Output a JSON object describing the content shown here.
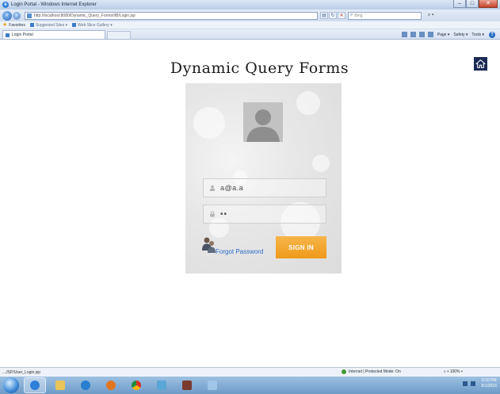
{
  "window": {
    "title": "Login Portal - Windows Internet Explorer",
    "minimize": "–",
    "maximize": "□",
    "close": "✕"
  },
  "addressbar": {
    "url": "http://localhost:8080/Dynamic_Query_Forms/IIB/Login.jsp",
    "search_placeholder": "Bing"
  },
  "favorites": {
    "label": "Favorites",
    "items": [
      "Suggested Sites ▾",
      "Web Slice Gallery ▾"
    ]
  },
  "tab": {
    "label": "Login Portal"
  },
  "commandbar": {
    "page": "Page ▾",
    "safety": "Safety ▾",
    "tools": "Tools ▾",
    "help": "?"
  },
  "page": {
    "title": "Dynamic Query Forms",
    "username_value": "a@a.a",
    "password_value": "••",
    "forgot_label": "Forgot Password",
    "signin_label": "SIGN IN"
  },
  "statusbar": {
    "link_url": "...JSP/User_Login.jsp",
    "zone": "Internet | Protected Mode: On",
    "zoom": "100%"
  },
  "taskbar": {
    "time": "6:10 PM",
    "date": "6/1/2016"
  },
  "colors": {
    "signin_orange": "#ef9a1a",
    "link_blue": "#2b6fcb",
    "home_button_navy": "#1a2a55"
  }
}
